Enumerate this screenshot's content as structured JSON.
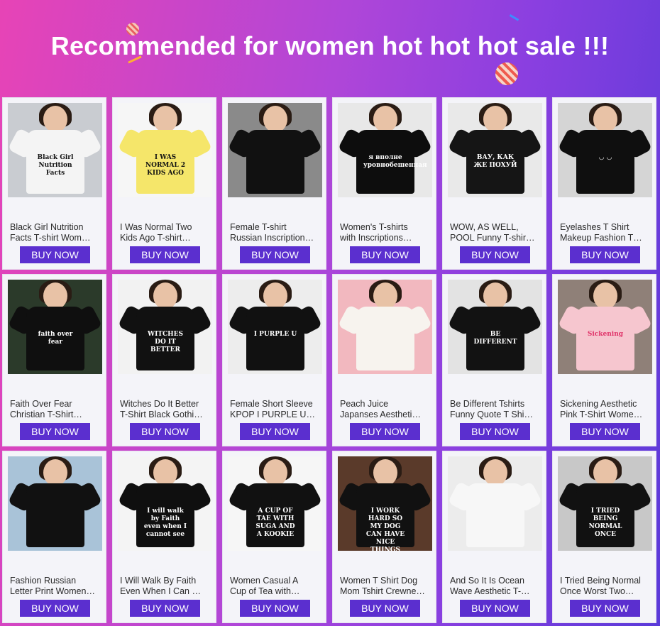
{
  "header": {
    "title": "Recommended for women hot hot hot sale !!!"
  },
  "colors": {
    "button": "#5b2fcf",
    "banner_left": "#e744b6",
    "banner_right": "#5a3ad9"
  },
  "products": [
    {
      "line1": "Black Girl Nutrition",
      "line2": "Facts T-shirt Wom…",
      "button": "BUY NOW",
      "bg": "#c9ccd1",
      "shirt": "#f4f4f4",
      "print": "Black Girl Nutrition Facts",
      "printColor": "#111"
    },
    {
      "line1": "I Was Normal Two",
      "line2": "Kids Ago T-shirt…",
      "button": "BUY NOW",
      "bg": "#f6f6f6",
      "shirt": "#f5e66a",
      "print": "I WAS NORMAL 2 KIDS AGO",
      "printColor": "#111"
    },
    {
      "line1": "Female T-shirt",
      "line2": "Russian Inscription…",
      "button": "BUY NOW",
      "bg": "#8a8a8a",
      "shirt": "#111",
      "print": "",
      "printColor": "#fff"
    },
    {
      "line1": "Women's T-shirts",
      "line2": "with Inscriptions…",
      "button": "BUY NOW",
      "bg": "#e8e8e8",
      "shirt": "#0d0d0d",
      "print": "я вполне уровнобешенная",
      "printColor": "#fff"
    },
    {
      "line1": "WOW, AS WELL,",
      "line2": "POOL Funny T-shir…",
      "button": "BUY NOW",
      "bg": "#e9e9e9",
      "shirt": "#151515",
      "print": "ВАУ, КАК ЖЕ ПОХУЙ",
      "printColor": "#fff"
    },
    {
      "line1": "Eyelashes T Shirt",
      "line2": "Makeup Fashion T…",
      "button": "BUY NOW",
      "bg": "#d5d5d5",
      "shirt": "#0f0f0f",
      "print": "◡ ◡",
      "printColor": "#fff"
    },
    {
      "line1": "Faith Over Fear",
      "line2": "Christian T-Shirt…",
      "button": "BUY NOW",
      "bg": "#2b3a2a",
      "shirt": "#0f0f0f",
      "print": "faith over fear",
      "printColor": "#fff"
    },
    {
      "line1": "Witches Do It Better",
      "line2": "T-Shirt Black Gothi…",
      "button": "BUY NOW",
      "bg": "#f2f2f2",
      "shirt": "#111",
      "print": "WITCHES DO IT BETTER",
      "printColor": "#fff"
    },
    {
      "line1": "Female Short Sleeve",
      "line2": "KPOP I PURPLE U…",
      "button": "BUY NOW",
      "bg": "#ededed",
      "shirt": "#111",
      "print": "I PURPLE U",
      "printColor": "#fff"
    },
    {
      "line1": "Peach Juice",
      "line2": "Japanses Aestheti…",
      "button": "BUY NOW",
      "bg": "#f2b8bf",
      "shirt": "#f7f3ee",
      "print": "",
      "printColor": "#d77"
    },
    {
      "line1": "Be Different Tshirts",
      "line2": "Funny Quote T Shi…",
      "button": "BUY NOW",
      "bg": "#e3e3e3",
      "shirt": "#121212",
      "print": "BE DIFFERENT",
      "printColor": "#fff"
    },
    {
      "line1": "Sickening Aesthetic",
      "line2": "Pink T-Shirt Wome…",
      "button": "BUY NOW",
      "bg": "#8f8078",
      "shirt": "#f6c6cf",
      "print": "Sickening",
      "printColor": "#e0356a"
    },
    {
      "line1": "Fashion Russian",
      "line2": "Letter Print Women…",
      "button": "BUY NOW",
      "bg": "#a9c3d8",
      "shirt": "#111",
      "print": "",
      "printColor": "#fff"
    },
    {
      "line1": "I Will Walk By Faith",
      "line2": "Even When I Can …",
      "button": "BUY NOW",
      "bg": "#f4f4f4",
      "shirt": "#0f0f0f",
      "print": "I will walk by Faith even when I cannot see",
      "printColor": "#fff"
    },
    {
      "line1": "Women Casual A",
      "line2": "Cup of Tea with…",
      "button": "BUY NOW",
      "bg": "#f6f6f6",
      "shirt": "#111",
      "print": "A CUP OF TAE WITH SUGA AND A KOOKIE",
      "printColor": "#fff"
    },
    {
      "line1": "Women T Shirt Dog",
      "line2": "Mom Tshirt Crewne…",
      "button": "BUY NOW",
      "bg": "#5a3a2a",
      "shirt": "#111",
      "print": "I WORK HARD SO MY DOG CAN HAVE NICE THINGS",
      "printColor": "#fff"
    },
    {
      "line1": "And So It Is Ocean",
      "line2": "Wave Aesthetic T-…",
      "button": "BUY NOW",
      "bg": "#ececec",
      "shirt": "#f7f7f7",
      "print": "",
      "printColor": "#333"
    },
    {
      "line1": "I Tried Being Normal",
      "line2": "Once Worst Two…",
      "button": "BUY NOW",
      "bg": "#c8c8c8",
      "shirt": "#111",
      "print": "I TRIED BEING NORMAL ONCE",
      "printColor": "#fff"
    }
  ]
}
